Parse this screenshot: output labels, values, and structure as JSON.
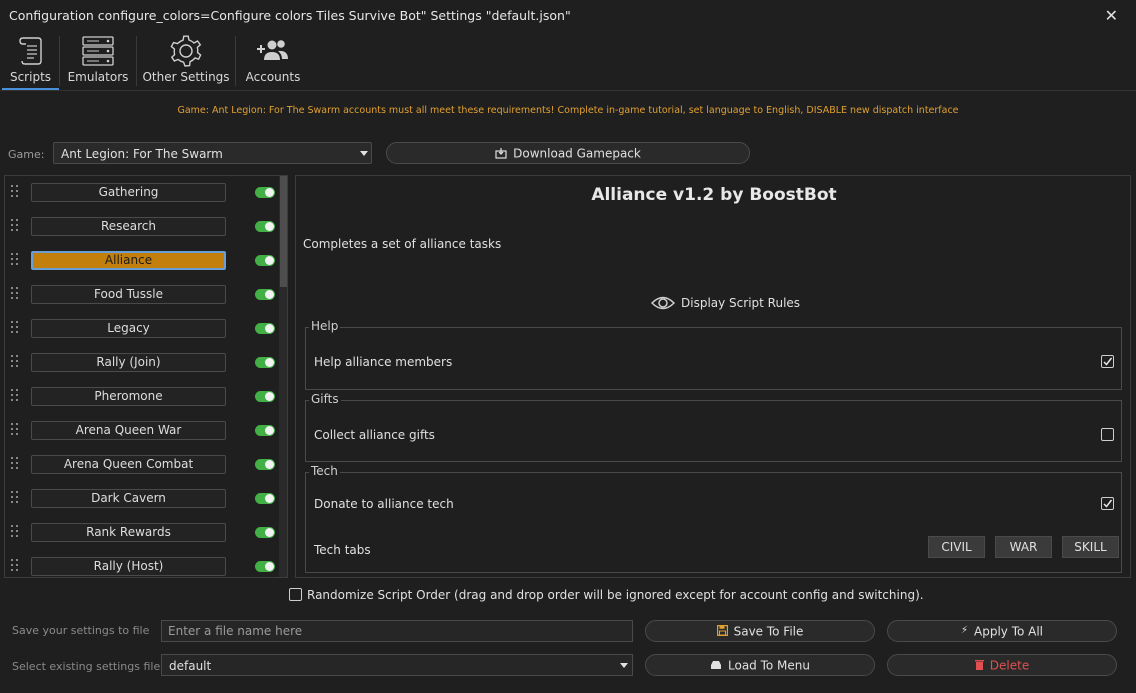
{
  "window": {
    "title": "Configuration configure_colors=Configure colors Tiles Survive Bot\" Settings \"default.json\""
  },
  "nav": {
    "tabs": [
      {
        "label": "Scripts",
        "icon": "scroll-icon",
        "active": true
      },
      {
        "label": "Emulators",
        "icon": "server-icon",
        "active": false
      },
      {
        "label": "Other Settings",
        "icon": "gear-icon",
        "active": false
      },
      {
        "label": "Accounts",
        "icon": "add-users-icon",
        "active": false
      }
    ]
  },
  "warning": "Game: Ant Legion: For The Swarm accounts must all meet these requirements! Complete in-game tutorial, set language to English, DISABLE new dispatch interface",
  "game": {
    "label": "Game:",
    "selected": "Ant Legion: For The Swarm",
    "download_label": "Download Gamepack"
  },
  "scripts": [
    {
      "name": "Gathering",
      "enabled": true,
      "active": false
    },
    {
      "name": "Research",
      "enabled": true,
      "active": false
    },
    {
      "name": "Alliance",
      "enabled": true,
      "active": true
    },
    {
      "name": "Food Tussle",
      "enabled": true,
      "active": false
    },
    {
      "name": "Legacy",
      "enabled": true,
      "active": false
    },
    {
      "name": "Rally (Join)",
      "enabled": true,
      "active": false
    },
    {
      "name": "Pheromone",
      "enabled": true,
      "active": false
    },
    {
      "name": "Arena Queen War",
      "enabled": true,
      "active": false
    },
    {
      "name": "Arena Queen Combat",
      "enabled": true,
      "active": false
    },
    {
      "name": "Dark Cavern",
      "enabled": true,
      "active": false
    },
    {
      "name": "Rank Rewards",
      "enabled": true,
      "active": false
    },
    {
      "name": "Rally (Host)",
      "enabled": true,
      "active": false
    }
  ],
  "detail": {
    "title": "Alliance v1.2 by BoostBot",
    "description": "Completes a set of alliance tasks",
    "rules_label": "Display Script Rules",
    "groups": {
      "help": {
        "title": "Help",
        "option": "Help alliance members",
        "checked": true
      },
      "gifts": {
        "title": "Gifts",
        "option": "Collect alliance gifts",
        "checked": false
      },
      "tech": {
        "title": "Tech",
        "option": "Donate to alliance tech",
        "checked": true,
        "tabs_label": "Tech tabs",
        "tabs": [
          "CIVIL",
          "WAR",
          "SKILL"
        ]
      }
    }
  },
  "randomize": {
    "label": "Randomize Script Order (drag and drop order will be ignored except for account config and switching).",
    "checked": false
  },
  "footer": {
    "save_label": "Save your settings to file",
    "file_placeholder": "Enter a file name here",
    "save_button": "Save To File",
    "apply_button": "Apply To All",
    "select_label": "Select existing settings file",
    "selected_file": "default",
    "load_button": "Load To Menu",
    "delete_button": "Delete"
  },
  "colors": {
    "accent": "#4a90d9",
    "warning": "#e0a030",
    "active_script": "#c27f0c",
    "toggle_on": "#43b047",
    "delete": "#e05050",
    "save_icon": "#e0a030"
  }
}
